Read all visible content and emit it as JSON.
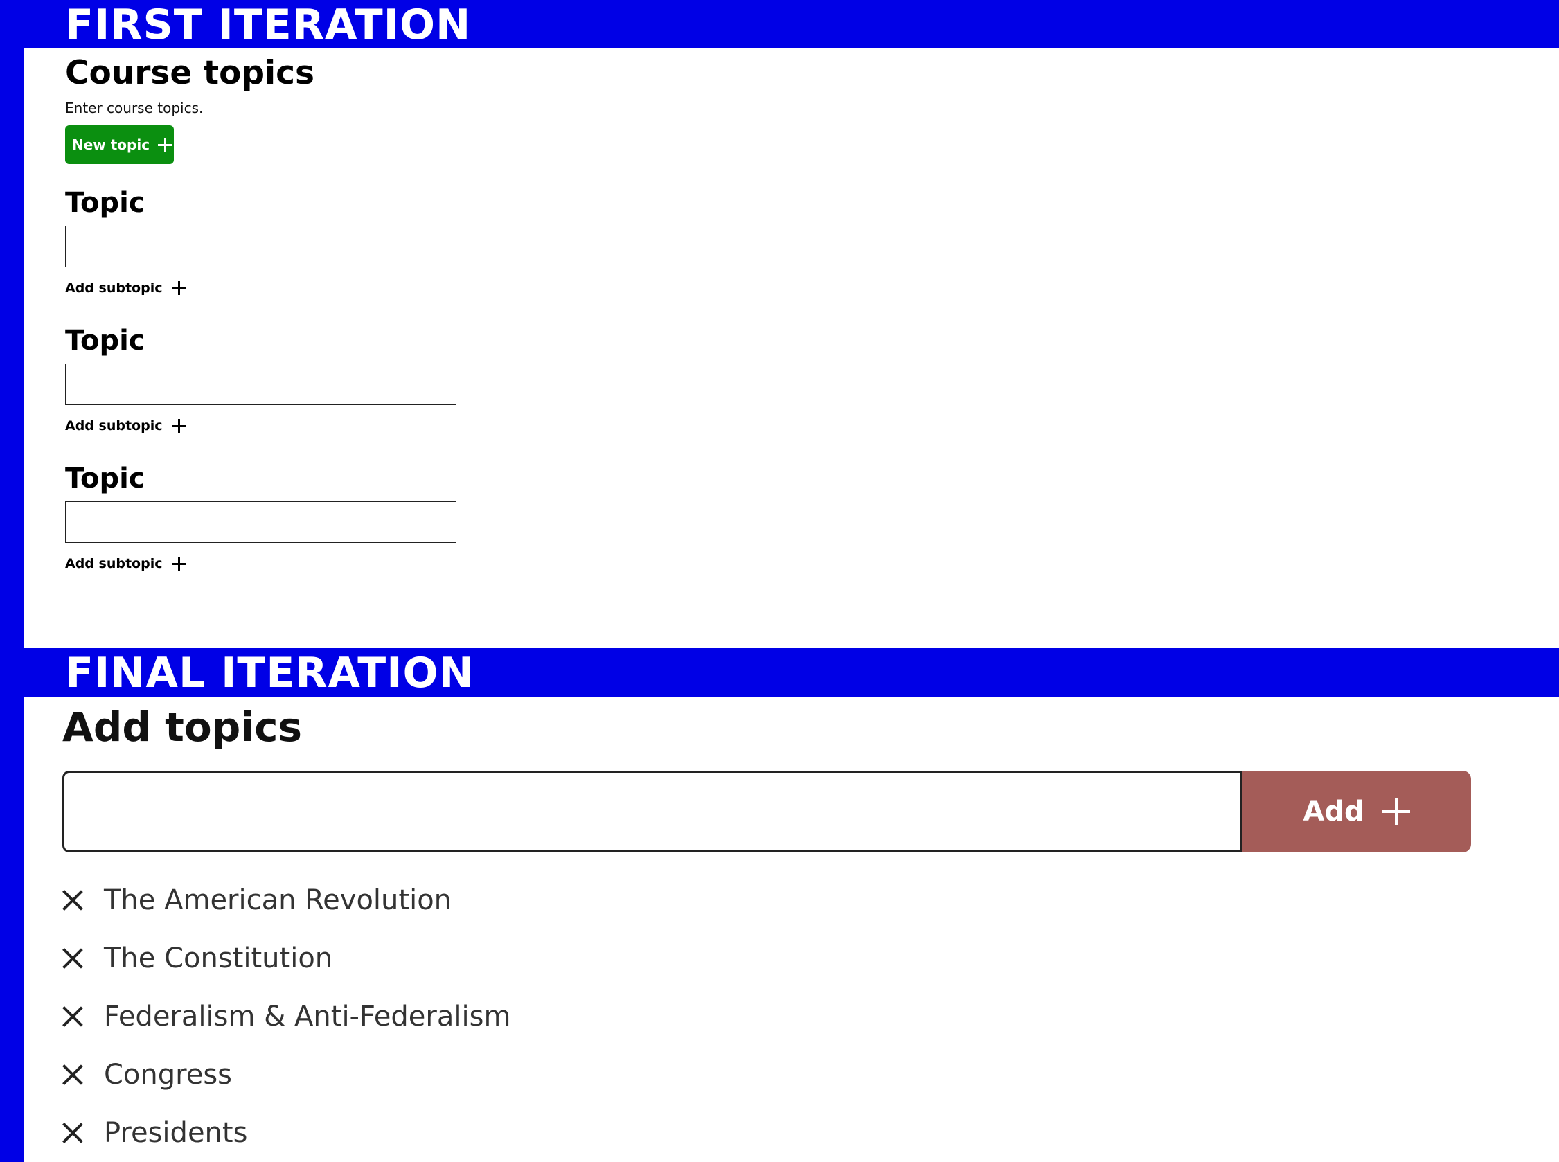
{
  "colors": {
    "banner_blue": "#0000e6",
    "new_topic_green": "#0b8f10",
    "add_button_red": "#a45c58"
  },
  "first_iteration": {
    "banner_title": "FIRST ITERATION",
    "title": "Course topics",
    "subtitle": "Enter course topics.",
    "new_topic_button": "New topic",
    "topics": [
      {
        "label": "Topic",
        "value": "",
        "add_subtopic": "Add subtopic"
      },
      {
        "label": "Topic",
        "value": "",
        "add_subtopic": "Add subtopic"
      },
      {
        "label": "Topic",
        "value": "",
        "add_subtopic": "Add subtopic"
      }
    ]
  },
  "final_iteration": {
    "banner_title": "FINAL ITERATION",
    "title": "Add topics",
    "input_value": "",
    "add_button": "Add",
    "topics": [
      "The American Revolution",
      "The Constitution",
      "Federalism & Anti-Federalism",
      "Congress",
      "Presidents"
    ]
  }
}
